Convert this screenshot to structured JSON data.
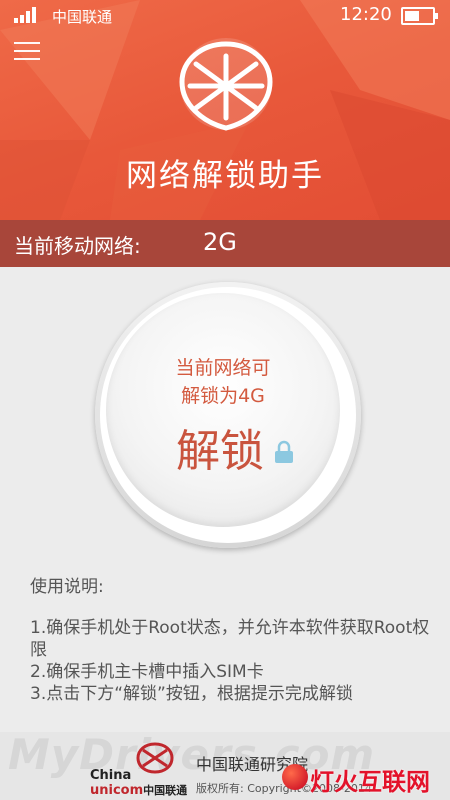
{
  "status_bar": {
    "carrier": "中国联通",
    "time": "12:20"
  },
  "header": {
    "title": "网络解锁助手"
  },
  "network": {
    "label": "当前移动网络:",
    "value": "2G"
  },
  "unlock": {
    "line1": "当前网络可",
    "line2": "解锁为4G",
    "button_label": "解锁"
  },
  "instructions": {
    "title": "使用说明:",
    "steps": [
      "1.确保手机处于Root状态，并允许本软件获取Root权限",
      "2.确保手机主卡槽中插入SIM卡",
      "3.点击下方“解锁”按钮，根据提示完成解锁"
    ]
  },
  "footer": {
    "org": "中国联通研究院",
    "copyright": "版权所有: Copyright©2008-2014",
    "logo_line1": "China",
    "logo_line2": "unicom",
    "logo_cn": "中国联通",
    "watermark": "MyDrivers.com",
    "brand": "灯火互联网"
  },
  "colors": {
    "header_red": "#e8583a",
    "net_bar": "#a8463a",
    "unlock_text": "#d35a3f"
  }
}
